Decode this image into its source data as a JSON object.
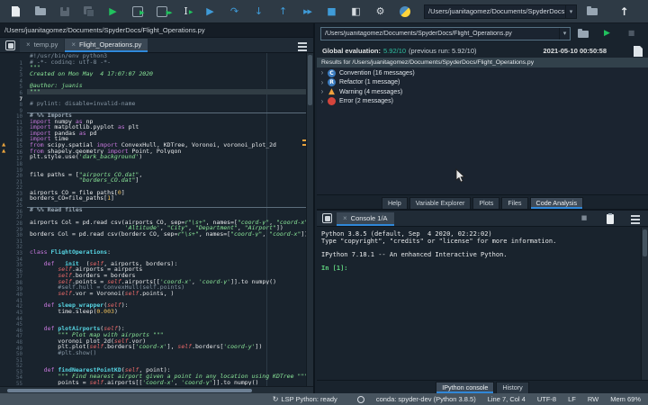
{
  "colors": {
    "accent": "#2f87d8",
    "run_green": "#21c25e",
    "debug_blue": "#3f9bd8",
    "warning_orange": "#f0a13c",
    "error_red": "#d4453c",
    "score_green": "#2fbfa0"
  },
  "toolbar": {
    "icons": [
      {
        "name": "new-file-icon",
        "kind": "doc"
      },
      {
        "name": "open-file-icon",
        "kind": "folder"
      },
      {
        "name": "save-icon",
        "kind": "floppy",
        "disabled": true
      },
      {
        "name": "save-all-icon",
        "kind": "floppy2",
        "disabled": true
      },
      {
        "name": "run-file-icon",
        "kind": "glyph",
        "glyph": "▶",
        "color": "#21c25e"
      },
      {
        "name": "run-cell-icon",
        "kind": "cellrun"
      },
      {
        "name": "run-cell-advance-icon",
        "kind": "cellrunadv"
      },
      {
        "name": "run-selection-icon",
        "kind": "ibeam"
      },
      {
        "name": "debug-file-icon",
        "kind": "glyph",
        "glyph": "▶",
        "color": "#3f9bd8"
      },
      {
        "name": "step-over-icon",
        "kind": "glyph",
        "glyph": "↷",
        "color": "#3f9bd8"
      },
      {
        "name": "step-into-icon",
        "kind": "glyph",
        "glyph": "↓",
        "color": "#3f9bd8"
      },
      {
        "name": "step-out-icon",
        "kind": "glyph",
        "glyph": "↑",
        "color": "#3f9bd8"
      },
      {
        "name": "continue-debug-icon",
        "kind": "glyph",
        "glyph": "▶▶",
        "color": "#3f9bd8",
        "small": true
      },
      {
        "name": "stop-debug-icon",
        "kind": "glyph",
        "glyph": "■",
        "color": "#3f9bd8"
      },
      {
        "name": "maximize-pane-icon",
        "kind": "glyph",
        "glyph": "◧",
        "color": "#d5dbe0"
      },
      {
        "name": "preferences-wrench-icon",
        "kind": "glyph",
        "glyph": "⚙",
        "color": "#d5dbe0"
      },
      {
        "name": "python-path-icon",
        "kind": "python"
      }
    ],
    "workdir": "/Users/juanitagomez/Documents/SpyderDocs",
    "dropdown_glyph": "▾",
    "up_glyph": "↑"
  },
  "editor_pane": {
    "path": "/Users/juanitagomez/Documents/SpyderDocs/Flight_Operations.py",
    "tabs": [
      {
        "label": "temp.py",
        "active": false
      },
      {
        "label": "Flight_Operations.py",
        "active": true
      }
    ],
    "code": {
      "lines": [
        {
          "n": 1,
          "segs": [
            [
              "c",
              "#!/usr/bin/env python3"
            ]
          ]
        },
        {
          "n": 2,
          "segs": [
            [
              "c",
              "# -*- coding: utf-8 -*-"
            ]
          ]
        },
        {
          "n": 3,
          "segs": [
            [
              "s",
              "\"\"\""
            ]
          ]
        },
        {
          "n": 4,
          "segs": [
            [
              "s",
              "Created on Mon May  4 17:07:07 2020"
            ]
          ]
        },
        {
          "n": 5,
          "segs": []
        },
        {
          "n": 6,
          "segs": [
            [
              "s",
              "@author: juanis"
            ]
          ]
        },
        {
          "n": 7,
          "cur": true,
          "segs": [
            [
              "s",
              "\"\"\""
            ]
          ]
        },
        {
          "n": 8,
          "segs": []
        },
        {
          "n": 9,
          "segs": [
            [
              "c",
              "# pylint: disable=invalid-name"
            ]
          ]
        },
        {
          "n": 10,
          "segs": []
        },
        {
          "n": 11,
          "cell": true,
          "segs": [
            [
              "cc",
              "# %% Imports"
            ]
          ]
        },
        {
          "n": 12,
          "segs": [
            [
              "k",
              "import "
            ],
            [
              "t",
              "numpy "
            ],
            [
              "k",
              "as "
            ],
            [
              "t",
              "np"
            ]
          ]
        },
        {
          "n": 13,
          "segs": [
            [
              "k",
              "import "
            ],
            [
              "t",
              "matplotlib.pyplot "
            ],
            [
              "k",
              "as "
            ],
            [
              "t",
              "plt"
            ]
          ]
        },
        {
          "n": 14,
          "segs": [
            [
              "k",
              "import "
            ],
            [
              "t",
              "pandas "
            ],
            [
              "k",
              "as "
            ],
            [
              "t",
              "pd"
            ]
          ]
        },
        {
          "n": 15,
          "segs": [
            [
              "k",
              "import "
            ],
            [
              "t",
              "time"
            ]
          ]
        },
        {
          "n": 16,
          "w": true,
          "segs": [
            [
              "k",
              "from "
            ],
            [
              "t",
              "scipy.spatial "
            ],
            [
              "k",
              "import "
            ],
            [
              "t",
              "ConvexHull, KDTree, Voronoi, voronoi_plot_2d"
            ]
          ]
        },
        {
          "n": 17,
          "w": true,
          "segs": [
            [
              "k",
              "from "
            ],
            [
              "t",
              "shapely.geometry "
            ],
            [
              "k",
              "import "
            ],
            [
              "t",
              "Point, Polygon"
            ]
          ]
        },
        {
          "n": 18,
          "segs": [
            [
              "t",
              "plt.style.use("
            ],
            [
              "s",
              "'dark_background'"
            ],
            [
              "t",
              ")"
            ]
          ]
        },
        {
          "n": 19,
          "segs": []
        },
        {
          "n": 20,
          "segs": []
        },
        {
          "n": 21,
          "segs": [
            [
              "t",
              "file_paths = ["
            ],
            [
              "s",
              "\"airports_CO.dat\""
            ],
            [
              "t",
              ","
            ]
          ]
        },
        {
          "n": 22,
          "segs": [
            [
              "t",
              "              "
            ],
            [
              "s",
              "\"borders_CO.dat\""
            ],
            [
              "t",
              "]"
            ]
          ]
        },
        {
          "n": 23,
          "segs": []
        },
        {
          "n": 24,
          "segs": [
            [
              "t",
              "airports_CO = file_paths["
            ],
            [
              "n",
              "0"
            ],
            [
              "t",
              "]"
            ]
          ]
        },
        {
          "n": 25,
          "segs": [
            [
              "t",
              "borders_CO=file_paths["
            ],
            [
              "n",
              "1"
            ],
            [
              "t",
              "]"
            ]
          ]
        },
        {
          "n": 26,
          "segs": []
        },
        {
          "n": 27,
          "cell": true,
          "segs": [
            [
              "cc",
              "# %% Read files"
            ]
          ]
        },
        {
          "n": 28,
          "segs": []
        },
        {
          "n": 29,
          "segs": [
            [
              "t",
              "airports_Col = pd.read_csv(airports_CO, sep="
            ],
            [
              "s",
              "r\"\\s+\""
            ],
            [
              "t",
              ", names=["
            ],
            [
              "s",
              "\"coord-y\""
            ],
            [
              "t",
              ", "
            ],
            [
              "s",
              "\"coord-x\""
            ],
            [
              "t",
              ","
            ]
          ]
        },
        {
          "n": 30,
          "segs": [
            [
              "t",
              "                           "
            ],
            [
              "s",
              "'Altitude'"
            ],
            [
              "t",
              ", "
            ],
            [
              "s",
              "\"City\""
            ],
            [
              "t",
              ", "
            ],
            [
              "s",
              "\"Department\""
            ],
            [
              "t",
              ", "
            ],
            [
              "s",
              "\"Airport\""
            ],
            [
              "t",
              "])"
            ]
          ]
        },
        {
          "n": 31,
          "segs": [
            [
              "t",
              "borders_Col = pd.read_csv(borders_CO, sep="
            ],
            [
              "s",
              "r\"\\s+\""
            ],
            [
              "t",
              ", names=["
            ],
            [
              "s",
              "\"coord-y\""
            ],
            [
              "t",
              ", "
            ],
            [
              "s",
              "\"coord-x\""
            ],
            [
              "t",
              "])"
            ]
          ]
        },
        {
          "n": 32,
          "segs": []
        },
        {
          "n": 33,
          "segs": []
        },
        {
          "n": 34,
          "segs": [
            [
              "k",
              "class "
            ],
            [
              "d",
              "FlightOperations"
            ],
            [
              "t",
              ":"
            ]
          ]
        },
        {
          "n": 35,
          "segs": []
        },
        {
          "n": 36,
          "segs": [
            [
              "t",
              "    "
            ],
            [
              "k",
              "def "
            ],
            [
              "d",
              "__init__"
            ],
            [
              "t",
              "("
            ],
            [
              "i",
              "self"
            ],
            [
              "t",
              ", airports, borders):"
            ]
          ]
        },
        {
          "n": 37,
          "segs": [
            [
              "t",
              "        "
            ],
            [
              "i",
              "self"
            ],
            [
              "t",
              ".airports = airports"
            ]
          ]
        },
        {
          "n": 38,
          "segs": [
            [
              "t",
              "        "
            ],
            [
              "i",
              "self"
            ],
            [
              "t",
              ".borders = borders"
            ]
          ]
        },
        {
          "n": 39,
          "segs": [
            [
              "t",
              "        "
            ],
            [
              "i",
              "self"
            ],
            [
              "t",
              ".points = "
            ],
            [
              "i",
              "self"
            ],
            [
              "t",
              ".airports[["
            ],
            [
              "s",
              "'coord-x'"
            ],
            [
              "t",
              ", "
            ],
            [
              "s",
              "'coord-y'"
            ],
            [
              "t",
              "]].to_numpy()"
            ]
          ]
        },
        {
          "n": 40,
          "segs": [
            [
              "c",
              "        #self.hull = ConvexHull(self.points)"
            ]
          ]
        },
        {
          "n": 41,
          "segs": [
            [
              "t",
              "        "
            ],
            [
              "i",
              "self"
            ],
            [
              "t",
              ".vor = Voronoi("
            ],
            [
              "i",
              "self"
            ],
            [
              "t",
              ".points, )"
            ]
          ]
        },
        {
          "n": 42,
          "segs": []
        },
        {
          "n": 43,
          "segs": [
            [
              "t",
              "    "
            ],
            [
              "k",
              "def "
            ],
            [
              "d",
              "sleep_wrapper"
            ],
            [
              "t",
              "("
            ],
            [
              "i",
              "self"
            ],
            [
              "t",
              "):"
            ]
          ]
        },
        {
          "n": 44,
          "segs": [
            [
              "t",
              "        time.sleep("
            ],
            [
              "n",
              "0.003"
            ],
            [
              "t",
              ")"
            ]
          ]
        },
        {
          "n": 45,
          "segs": []
        },
        {
          "n": 46,
          "segs": []
        },
        {
          "n": 47,
          "segs": [
            [
              "t",
              "    "
            ],
            [
              "k",
              "def "
            ],
            [
              "d",
              "plotAirports"
            ],
            [
              "t",
              "("
            ],
            [
              "i",
              "self"
            ],
            [
              "t",
              "):"
            ]
          ]
        },
        {
          "n": 48,
          "segs": [
            [
              "t",
              "        "
            ],
            [
              "s",
              "\"\"\" Plot map with airports \"\"\""
            ]
          ]
        },
        {
          "n": 49,
          "segs": [
            [
              "t",
              "        voronoi_plot_2d("
            ],
            [
              "i",
              "self"
            ],
            [
              "t",
              ".vor)"
            ]
          ]
        },
        {
          "n": 50,
          "segs": [
            [
              "t",
              "        plt.plot("
            ],
            [
              "i",
              "self"
            ],
            [
              "t",
              ".borders["
            ],
            [
              "s",
              "'coord-x'"
            ],
            [
              "t",
              "], "
            ],
            [
              "i",
              "self"
            ],
            [
              "t",
              ".borders["
            ],
            [
              "s",
              "'coord-y'"
            ],
            [
              "t",
              "])"
            ]
          ]
        },
        {
          "n": 51,
          "segs": [
            [
              "c",
              "        #plt.show()"
            ]
          ]
        },
        {
          "n": 52,
          "segs": []
        },
        {
          "n": 53,
          "segs": []
        },
        {
          "n": 54,
          "segs": [
            [
              "t",
              "    "
            ],
            [
              "k",
              "def "
            ],
            [
              "d",
              "findNearestPointKD"
            ],
            [
              "t",
              "("
            ],
            [
              "i",
              "self"
            ],
            [
              "t",
              ", point):"
            ]
          ]
        },
        {
          "n": 55,
          "segs": [
            [
              "t",
              "        "
            ],
            [
              "s",
              "\"\"\" Find nearest airport given a point in any location using KDTree \"\"\""
            ]
          ]
        },
        {
          "n": 56,
          "segs": [
            [
              "t",
              "        points = "
            ],
            [
              "i",
              "self"
            ],
            [
              "t",
              ".airports[["
            ],
            [
              "s",
              "'coord-x'"
            ],
            [
              "t",
              ", "
            ],
            [
              "s",
              "'coord-y'"
            ],
            [
              "t",
              "]].to_numpy()"
            ]
          ]
        }
      ]
    }
  },
  "analysis_pane": {
    "file_combo": "/Users/juanitagomez/Documents/SpyderDocs/Flight_Operations.py",
    "dropdown_glyph": "▾",
    "global_eval_label": "Global evaluation:",
    "score": "5.92/10",
    "previous": "(previous run: 5.92/10)",
    "timestamp": "2021-05-10 00:50:58",
    "results_header": "Results for /Users/juanitagomez/Documents/SpyderDocs/Flight_Operations.py",
    "tree": [
      {
        "kind": "convention",
        "letter": "C",
        "label": "Convention (16 messages)"
      },
      {
        "kind": "refactor",
        "letter": "R",
        "label": "Refactor (1 message)"
      },
      {
        "kind": "warning",
        "letter": "▲",
        "label": "Warning (4 messages)"
      },
      {
        "kind": "error",
        "letter": "",
        "label": "Error (2 messages)"
      }
    ],
    "chevron_glyph": "›",
    "tabs": [
      {
        "label": "Help",
        "active": false
      },
      {
        "label": "Variable Explorer",
        "active": false
      },
      {
        "label": "Plots",
        "active": false
      },
      {
        "label": "Files",
        "active": false
      },
      {
        "label": "Code Analysis",
        "active": true
      }
    ]
  },
  "console_pane": {
    "tab": {
      "label": "Console 1/A",
      "active": true
    },
    "lines": [
      "Python 3.8.5 (default, Sep  4 2020, 02:22:02)",
      "Type \"copyright\", \"credits\" or \"license\" for more information.",
      "",
      "IPython 7.18.1 -- An enhanced Interactive Python.",
      ""
    ],
    "prompt": "In [1]:",
    "tabs": [
      {
        "label": "IPython console",
        "active": true
      },
      {
        "label": "History",
        "active": false
      }
    ]
  },
  "statusbar": {
    "items": [
      {
        "name": "lsp-status",
        "icon": "↻",
        "label": "LSP Python: ready"
      },
      {
        "name": "interpreter-status",
        "icon": "ring",
        "label": "conda: spyder-dev (Python 3.8.5)"
      },
      {
        "name": "cursor-position",
        "label": "Line 7, Col 4"
      },
      {
        "name": "encoding",
        "label": "UTF-8"
      },
      {
        "name": "eol-status",
        "label": "LF"
      },
      {
        "name": "readwrite-status",
        "label": "RW"
      },
      {
        "name": "memory-status",
        "label": "Mem 69%"
      }
    ]
  }
}
